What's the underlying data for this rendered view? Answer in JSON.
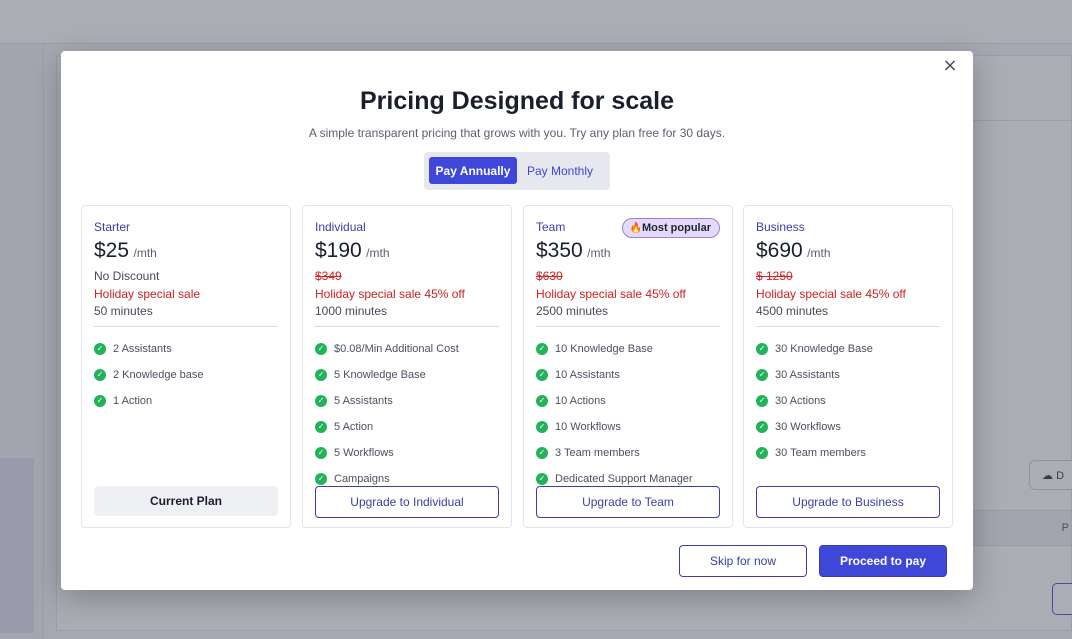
{
  "background": {
    "download_label": "D",
    "table_header_label": "P"
  },
  "modal": {
    "title": "Pricing Designed for scale",
    "subtitle": "A simple transparent pricing that grows with you. Try any plan free for 30 days.",
    "close_icon": "×",
    "toggle": {
      "annually": "Pay Annually",
      "monthly": "Pay Monthly",
      "selected": "annually"
    },
    "plans": [
      {
        "name": "Starter",
        "price": "$25",
        "per": "/mth",
        "discount_note": "No Discount",
        "sale": "Holiday special sale",
        "minutes": "50 minutes",
        "features": [
          "2 Assistants",
          "2 Knowledge base",
          "1 Action"
        ],
        "cta": "Current Plan"
      },
      {
        "name": "Individual",
        "price": "$190",
        "per": "/mth",
        "old_price": "$349",
        "sale": "Holiday special sale 45% off",
        "minutes": "1000 minutes",
        "features": [
          "$0.08/Min Additional Cost",
          "5 Knowledge Base",
          "5 Assistants",
          "5 Action",
          "5 Workflows",
          "Campaigns"
        ],
        "cta": "Upgrade to Individual"
      },
      {
        "name": "Team",
        "price": "$350",
        "per": "/mth",
        "old_price": "$630",
        "sale": "Holiday special sale 45% off",
        "minutes": "2500 minutes",
        "badge": "Most popular",
        "badge_icon": "🔥",
        "features": [
          "10 Knowledge Base",
          "10 Assistants",
          "10 Actions",
          "10 Workflows",
          "3 Team members",
          "Dedicated Support Manager"
        ],
        "cta": "Upgrade to Team"
      },
      {
        "name": "Business",
        "price": "$690",
        "per": "/mth",
        "old_price": "$ 1250",
        "sale": "Holiday special sale 45% off",
        "minutes": "4500 minutes",
        "features": [
          "30 Knowledge Base",
          "30 Assistants",
          "30 Actions",
          "30 Workflows",
          "30 Team members"
        ],
        "cta": "Upgrade to Business"
      }
    ],
    "footer": {
      "skip": "Skip for now",
      "proceed": "Proceed to pay"
    }
  },
  "colors": {
    "accent": "#3f47d9",
    "sale": "#d32020",
    "check": "#22b35a",
    "badge_bg": "#e4d9fb"
  }
}
